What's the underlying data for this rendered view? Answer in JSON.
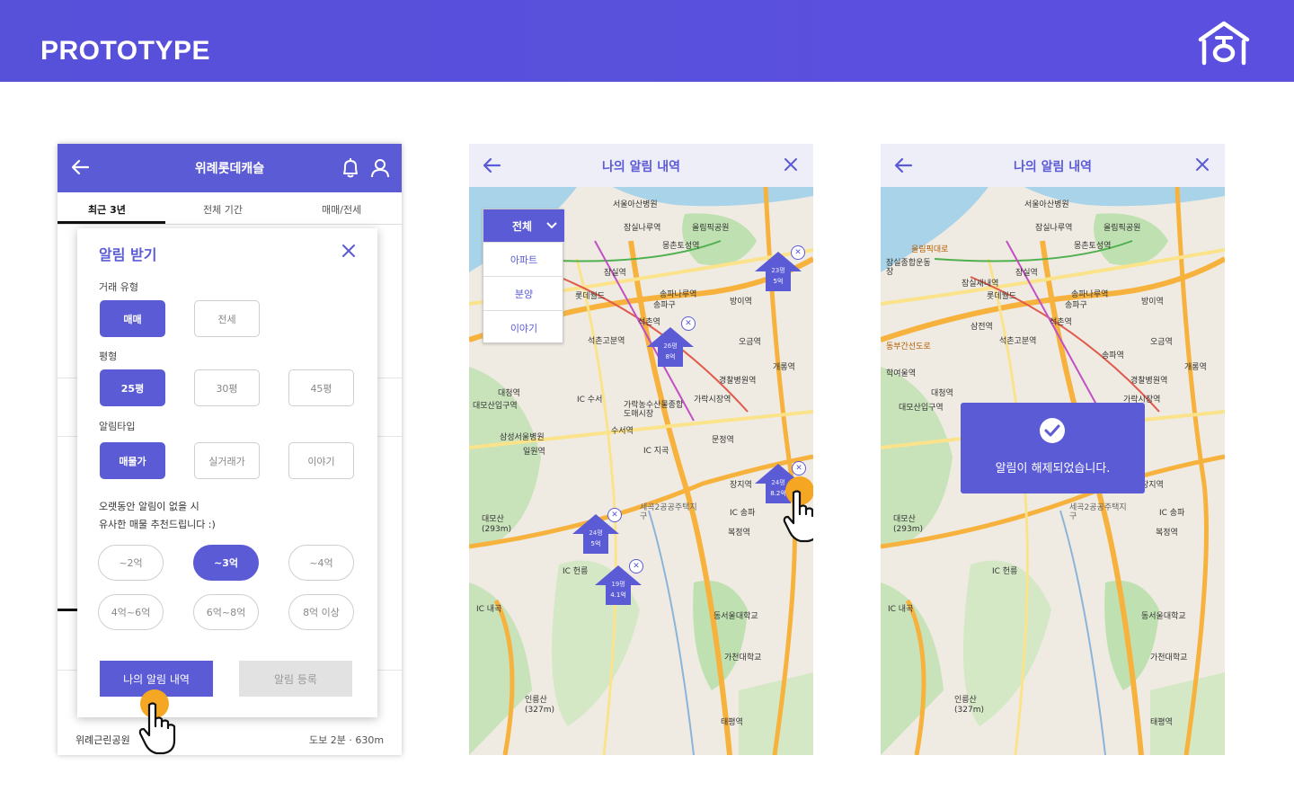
{
  "banner": {
    "title": "PROTOTYPE"
  },
  "colors": {
    "primary": "#5b5bd6",
    "accent": "#f5a623",
    "banner": "#5750d9"
  },
  "screen1": {
    "header_title": "위례롯데캐슬",
    "tabs": [
      "최근 3년",
      "전체 기간",
      "매매/전세"
    ],
    "modal": {
      "title": "알림 받기",
      "deal_type_label": "거래 유형",
      "deal_types": [
        "매매",
        "전세"
      ],
      "size_label": "평형",
      "sizes": [
        "25평",
        "30평",
        "45평"
      ],
      "alert_type_label": "알림타입",
      "alert_types": [
        "매물가",
        "실거래가",
        "이야기"
      ],
      "recommend_line1": "오랫동안 알림이 없을 시",
      "recommend_line2": "유사한 매물 추천드립니다 :)",
      "prices": [
        "~2억",
        "~3억",
        "~4억",
        "4억~6억",
        "6억~8억",
        "8억 이상"
      ],
      "my_alerts_button": "나의 알림 내역",
      "register_button": "알림 등록"
    },
    "bottom_rows": [
      {
        "name": "위례근린공원",
        "distance": "도보 2분 · 630m"
      }
    ]
  },
  "screen2": {
    "header_title": "나의 알림 내역",
    "dropdown": {
      "selected": "전체",
      "options": [
        "아파트",
        "분양",
        "이야기"
      ]
    },
    "markers": [
      {
        "top": "23평",
        "bottom": "5억"
      },
      {
        "top": "26평",
        "bottom": "8억"
      },
      {
        "top": "24평",
        "bottom": "8.2억"
      },
      {
        "top": "24평",
        "bottom": "5억"
      },
      {
        "top": "19평",
        "bottom": "4.1억"
      }
    ]
  },
  "screen3": {
    "header_title": "나의 알림 내역",
    "toast_text": "알림이 해제되었습니다."
  },
  "map_labels": [
    "서울아산병원",
    "잠실나루역",
    "올림픽공원",
    "몽촌토성역",
    "잠실역",
    "송파나루역",
    "송파구",
    "방이역",
    "롯데월드",
    "석촌역",
    "석촌고분역",
    "오금역",
    "개롱역",
    "경찰병원역",
    "가락시장역",
    "대청역",
    "IC 수서",
    "가락농수산물종합도매시장",
    "수서역",
    "대모산입구역",
    "삼성서울병원",
    "일원역",
    "문정역",
    "IC 지곡",
    "장지역",
    "세곡2공공주택지구",
    "IC 송파",
    "복정역",
    "대모산(293m)",
    "IC 헌릉",
    "IC 내곡",
    "동서울대학교",
    "가천대학교",
    "인릉산(327m)",
    "태평역",
    "송파역",
    "잠실새내역",
    "잠실종합운동장",
    "삼전역",
    "학여울역",
    "올림픽대로",
    "동부간선도로"
  ]
}
